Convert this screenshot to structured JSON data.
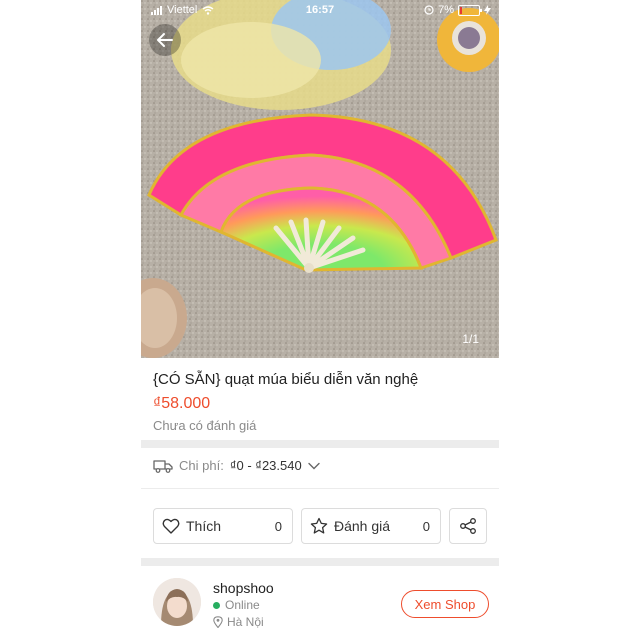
{
  "status_bar": {
    "carrier": "Viettel",
    "time": "16:57",
    "battery": "7%",
    "icons": [
      "signal-icon",
      "wifi-icon",
      "alarm-icon",
      "battery-icon",
      "charging-icon"
    ]
  },
  "gallery": {
    "counter": "1/1",
    "back_icon": "back-arrow-icon"
  },
  "product": {
    "title": "{CÓ SẴN} quạt múa biểu diễn văn nghệ",
    "price": "₫58.000",
    "rating_text": "Chưa có đánh giá"
  },
  "shipping": {
    "icon": "truck-icon",
    "label": "Chi phí:",
    "value": "₫0 - ₫23.540",
    "chevron": "chevron-down-icon"
  },
  "actions": {
    "like_label": "Thích",
    "like_count": "0",
    "rate_label": "Đánh giá",
    "rate_count": "0",
    "share_icon": "share-icon"
  },
  "shop": {
    "name": "shopshoo",
    "status": "Online",
    "location": "Hà Nội",
    "view_button": "Xem Shop"
  },
  "colors": {
    "accent": "#ee4d2d",
    "online": "#27ae60",
    "muted_text": "#8a8a8a",
    "separator": "#ececec"
  }
}
